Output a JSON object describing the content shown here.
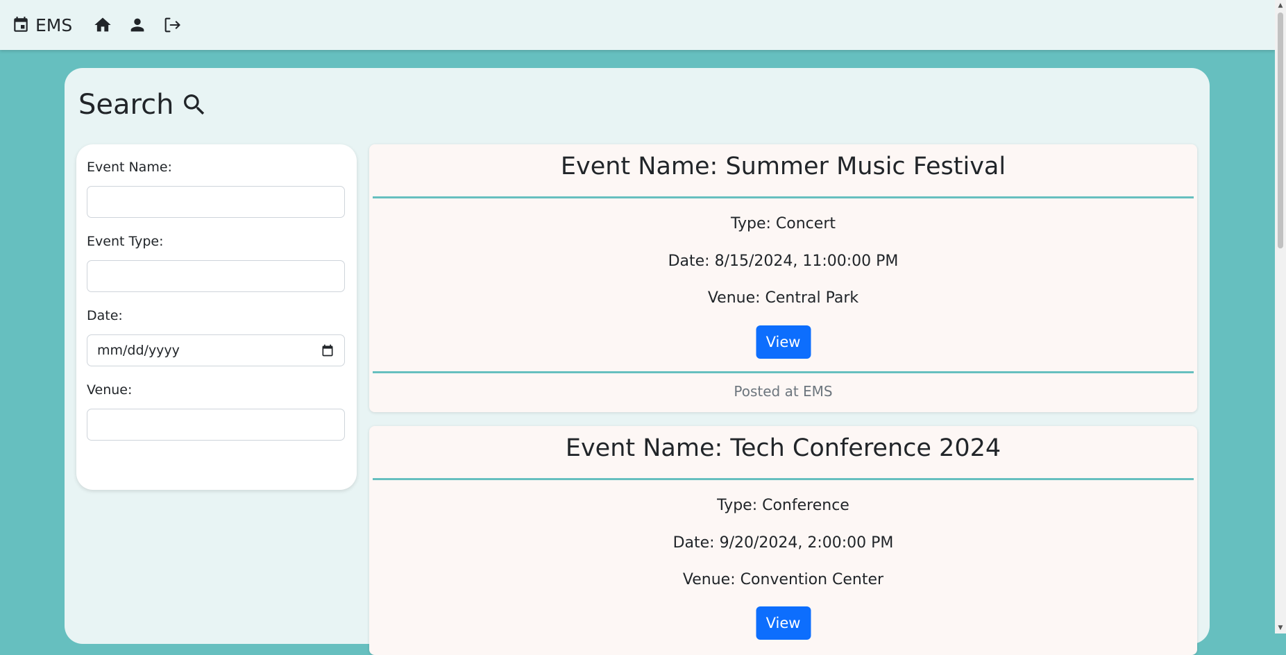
{
  "navbar": {
    "brand": "EMS",
    "brand_icon": "calendar-icon",
    "icons": [
      "home-icon",
      "user-icon",
      "logout-icon"
    ]
  },
  "search": {
    "title": "Search",
    "icon": "search-icon"
  },
  "filters": {
    "event_name_label": "Event Name:",
    "event_type_label": "Event Type:",
    "date_label": "Date:",
    "date_placeholder": "mm/dd/yyyy",
    "venue_label": "Venue:"
  },
  "events": [
    {
      "title": "Event Name: Summer Music Festival",
      "type": "Type: Concert",
      "date": "Date: 8/15/2024, 11:00:00 PM",
      "venue": "Venue: Central Park",
      "button": "View",
      "footer": "Posted at EMS"
    },
    {
      "title": "Event Name: Tech Conference 2024",
      "type": "Type: Conference",
      "date": "Date: 9/20/2024, 2:00:00 PM",
      "venue": "Venue: Convention Center",
      "button": "View"
    }
  ],
  "colors": {
    "background": "#66bfbf",
    "panel": "#e8f4f4",
    "card": "#fdf7f5",
    "accent": "#66bfbf",
    "button": "#0d6efd"
  }
}
